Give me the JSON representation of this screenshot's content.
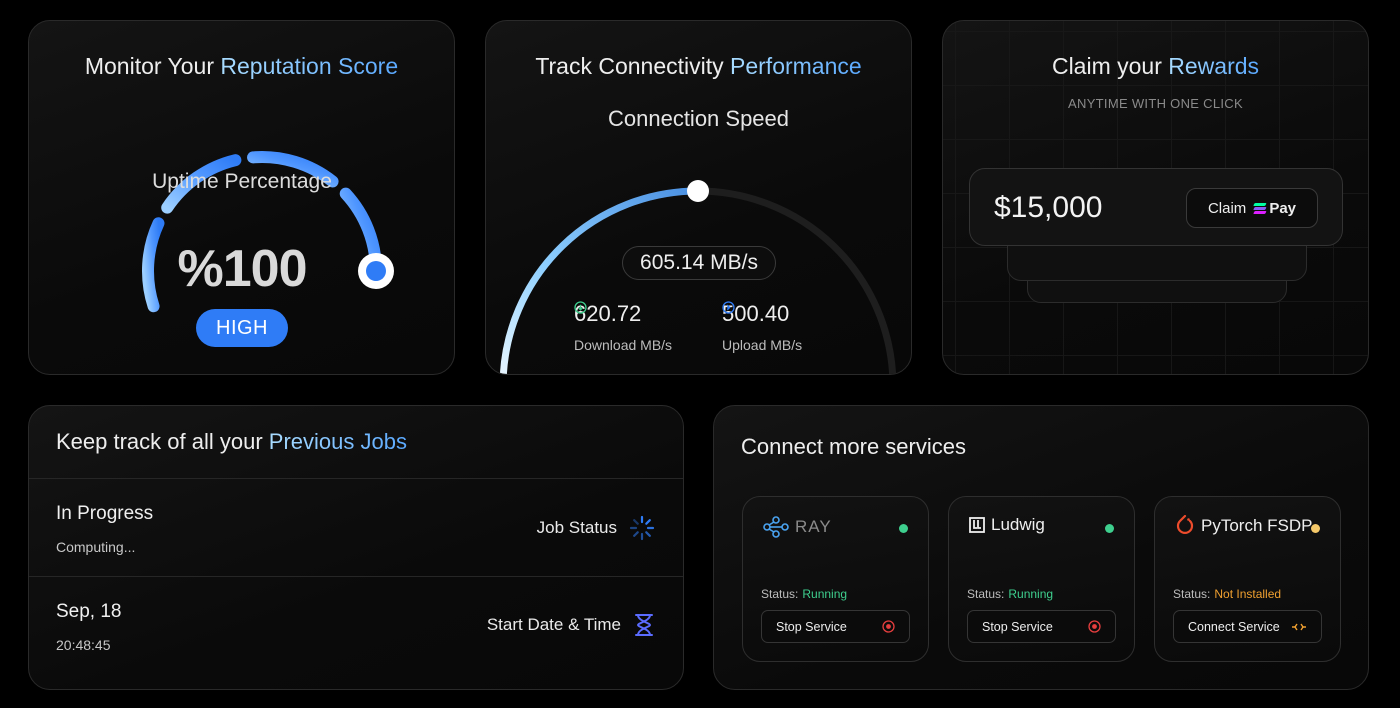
{
  "reputation": {
    "title_a": "Monitor Your",
    "title_b": "Reputation Score",
    "gauge_label": "Uptime Percentage",
    "value": "%100",
    "badge": "HIGH",
    "uptime_fraction": 1.0
  },
  "connectivity": {
    "title_a": "Track Connectivity",
    "title_b": "Performance",
    "subtitle": "Connection Speed",
    "speed": "605.14 MB/s",
    "download_value": "620.72",
    "download_label": "Download MB/s",
    "upload_value": "500.40",
    "upload_label": "Upload MB/s",
    "speed_fraction": 0.5
  },
  "rewards": {
    "title_a": "Claim your",
    "title_b": "Rewards",
    "subtitle": "ANYTIME WITH ONE CLICK",
    "amount": "$15,000",
    "claim_label": "Claim",
    "pay_label": "Pay"
  },
  "jobs": {
    "title_a": "Keep track of all your",
    "title_b": "Previous Jobs",
    "rows": [
      {
        "main": "In Progress",
        "sub": "Computing...",
        "right_label": "Job Status",
        "icon": "spinner-icon"
      },
      {
        "main": "Sep, 18",
        "sub": "20:48:45",
        "right_label": "Start Date & Time",
        "icon": "hourglass-icon"
      }
    ]
  },
  "services": {
    "title": "Connect more services",
    "status_prefix": "Status:",
    "items": [
      {
        "name": "RAY",
        "status": "Running",
        "status_color": "#3ecf8e",
        "dot_color": "#3ecf8e",
        "action": "Stop Service",
        "action_color": "#e53e3e",
        "icon": "ray-logo-icon"
      },
      {
        "name": "Ludwig",
        "status": "Running",
        "status_color": "#3ecf8e",
        "dot_color": "#3ecf8e",
        "action": "Stop Service",
        "action_color": "#e53e3e",
        "icon": "ludwig-logo-icon"
      },
      {
        "name": "PyTorch FSDP",
        "status": "Not Installed",
        "status_color": "#f0a030",
        "dot_color": "#f5c96a",
        "action": "Connect Service",
        "action_color": "#f0a030",
        "icon": "pytorch-logo-icon"
      }
    ]
  },
  "colors": {
    "accent_blue": "#2f7cf6",
    "accent_light": "#a9dcff",
    "running_green": "#3ecf8e",
    "warning_orange": "#f0a030",
    "stop_red": "#e53e3e"
  }
}
